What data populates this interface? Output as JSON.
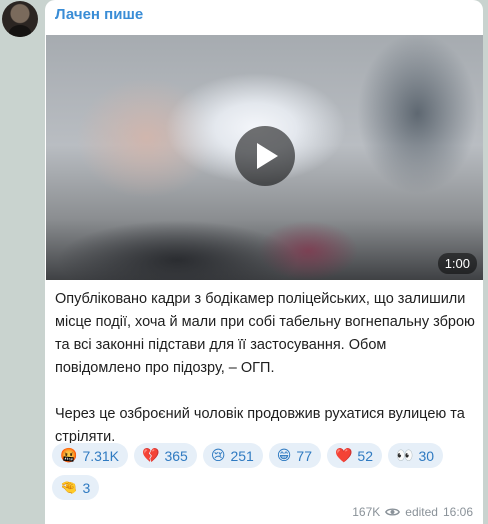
{
  "post": {
    "channel_name": "Лачен пише",
    "video_duration": "1:00",
    "paragraph_1": "Опубліковано кадри з бодікамер поліцейських, що залишили місце події, хоча й мали при собі табельну вогнепальну зброю та всі законні підстави для її застосування. Обом повідомлено про підозру, – ОГП.",
    "paragraph_2": "Через це озброєний чоловік продовжив рухатися вулицею та стріляти.",
    "views": "167K",
    "edited_label": "edited",
    "time": "16:06"
  },
  "reactions": [
    {
      "emoji": "🤬",
      "count": "7.31K"
    },
    {
      "emoji": "💔",
      "count": "365"
    },
    {
      "emoji": "😢",
      "count": "251"
    },
    {
      "emoji": "😁",
      "count": "77"
    },
    {
      "emoji": "❤️",
      "count": "52"
    },
    {
      "emoji": "👀",
      "count": "30"
    },
    {
      "emoji": "🤏",
      "count": "3"
    }
  ],
  "colors": {
    "accent": "#3a8dd6",
    "reaction_bg": "#e6eff8",
    "background": "#c9d3cf"
  }
}
